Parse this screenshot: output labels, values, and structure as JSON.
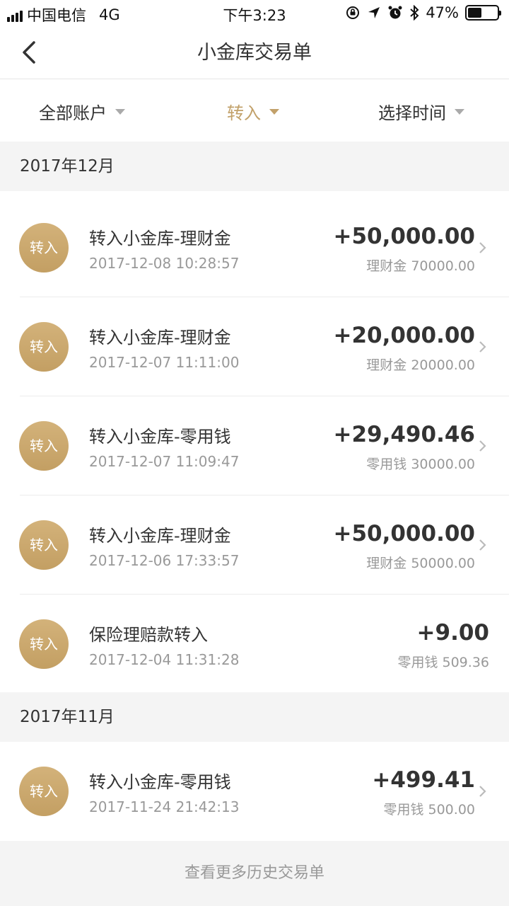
{
  "status_bar": {
    "carrier": "中国电信",
    "network": "4G",
    "time": "下午3:23",
    "battery": "47%",
    "battery_level": 0.47
  },
  "nav": {
    "title": "小金库交易单"
  },
  "filters": {
    "account": "全部账户",
    "type": "转入",
    "time": "选择时间"
  },
  "sections": [
    {
      "label": "2017年12月",
      "rows": [
        {
          "badge": "转入",
          "title": "转入小金库-理财金",
          "datetime": "2017-12-08  10:28:57",
          "amount": "+50,000.00",
          "sub": "理财金 70000.00"
        },
        {
          "badge": "转入",
          "title": "转入小金库-理财金",
          "datetime": "2017-12-07  11:11:00",
          "amount": "+20,000.00",
          "sub": "理财金 20000.00"
        },
        {
          "badge": "转入",
          "title": "转入小金库-零用钱",
          "datetime": "2017-12-07  11:09:47",
          "amount": "+29,490.46",
          "sub": "零用钱 30000.00"
        },
        {
          "badge": "转入",
          "title": "转入小金库-理财金",
          "datetime": "2017-12-06  17:33:57",
          "amount": "+50,000.00",
          "sub": "理财金 50000.00"
        },
        {
          "badge": "转入",
          "title": "保险理赔款转入",
          "datetime": "2017-12-04  11:31:28",
          "amount": "+9.00",
          "sub": "零用钱 509.36"
        }
      ]
    },
    {
      "label": "2017年11月",
      "rows": [
        {
          "badge": "转入",
          "title": "转入小金库-零用钱",
          "datetime": "2017-11-24  21:42:13",
          "amount": "+499.41",
          "sub": "零用钱 500.00"
        }
      ]
    }
  ],
  "footer": {
    "label": "查看更多历史交易单"
  },
  "colors": {
    "accent": "#c2a16a",
    "badge": "#c9a86b"
  }
}
